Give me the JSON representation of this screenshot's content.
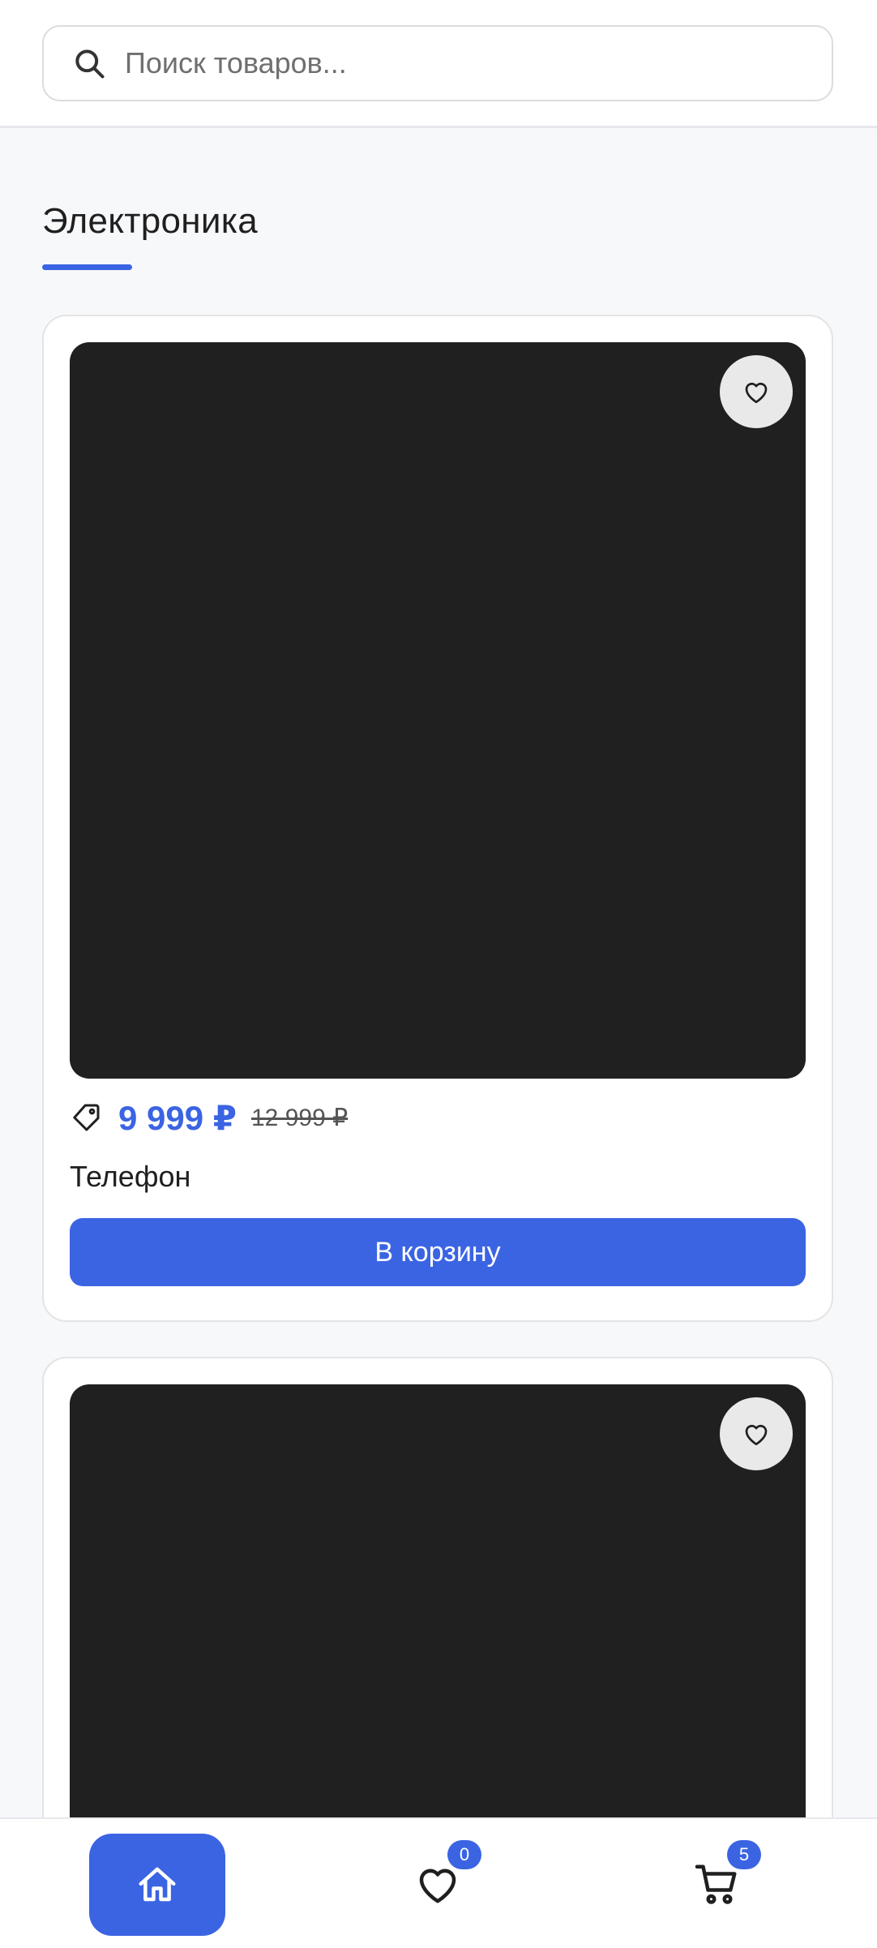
{
  "search": {
    "placeholder": "Поиск товаров..."
  },
  "section": {
    "title": "Электроника"
  },
  "products": [
    {
      "price": "9 999 ₽",
      "old_price": "12 999 ₽",
      "name": "Телефон",
      "add_to_cart_label": "В корзину"
    },
    {}
  ],
  "bottom_nav": {
    "favorites_count": "0",
    "cart_count": "5",
    "active_item": "home"
  },
  "colors": {
    "accent": "#3b64e3",
    "image_placeholder": "#202020",
    "background": "#f7f8fa"
  },
  "icons": [
    "search-icon",
    "heart-icon",
    "tag-icon",
    "home-icon",
    "cart-icon"
  ]
}
